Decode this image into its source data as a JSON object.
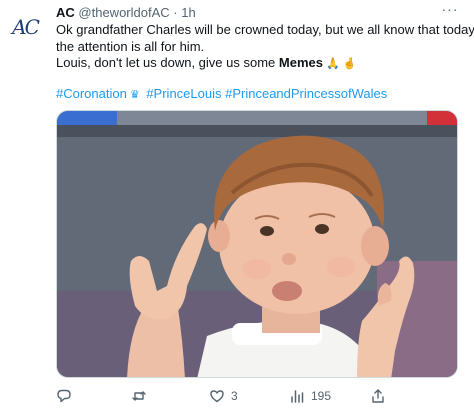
{
  "tweet": {
    "avatar_monogram": "AC",
    "author_name": "AC",
    "handle": "@theworldofAC",
    "separator": "·",
    "time": "1h",
    "more_label": "···",
    "line1": "Ok grandfather Charles will be crowned today, but we all know that today",
    "line2": "the attention is all for him.",
    "line3_prefix": "Louis, don't let us down, give us some ",
    "line3_bold": "Memes",
    "emojis": [
      "praying-hands-emoji",
      "crossed-fingers-emoji"
    ],
    "hashtags": [
      "#Coronation",
      "#PrinceLouis",
      "#PrinceandPrincessofWales"
    ],
    "crown_icon": "crown-emoji",
    "image": "photo of a young boy in a white shirt making a pouting face and pointing upward with both hands",
    "actions": {
      "reply": {
        "icon": "reply-icon",
        "count": ""
      },
      "retweet": {
        "icon": "retweet-icon",
        "count": ""
      },
      "like": {
        "icon": "heart-icon",
        "count": "3"
      },
      "views": {
        "icon": "analytics-icon",
        "count": "195"
      },
      "share": {
        "icon": "share-icon",
        "count": ""
      }
    },
    "colors": {
      "link": "#1d9bf0",
      "text": "#0f1419",
      "muted": "#536471"
    }
  }
}
